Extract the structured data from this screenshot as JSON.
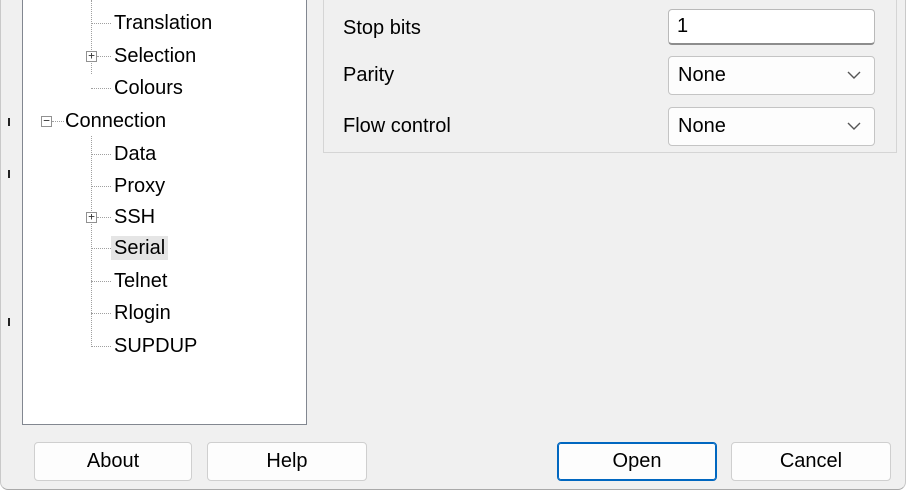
{
  "tree": {
    "items": [
      {
        "label": "Translation"
      },
      {
        "label": "Selection"
      },
      {
        "label": "Colours"
      },
      {
        "label": "Connection"
      },
      {
        "label": "Data"
      },
      {
        "label": "Proxy"
      },
      {
        "label": "SSH"
      },
      {
        "label": "Serial"
      },
      {
        "label": "Telnet"
      },
      {
        "label": "Rlogin"
      },
      {
        "label": "SUPDUP"
      }
    ],
    "expand_glyph": "+",
    "collapse_glyph": "−",
    "selected": "Serial"
  },
  "settings": {
    "stop_bits": {
      "label": "Stop bits",
      "value": "1"
    },
    "parity": {
      "label": "Parity",
      "value": "None"
    },
    "flow_control": {
      "label": "Flow control",
      "value": "None"
    }
  },
  "buttons": {
    "about": "About",
    "help": "Help",
    "open": "Open",
    "cancel": "Cancel"
  },
  "colors": {
    "default_button_border": "#0067c0",
    "selection_background": "#e5e5e5"
  }
}
